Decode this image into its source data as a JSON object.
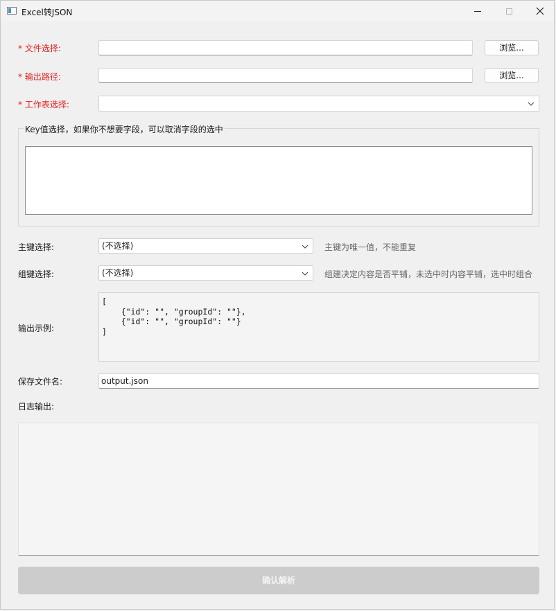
{
  "window": {
    "title": "Excel转JSON",
    "icons": {
      "app": "excel-json-app-icon",
      "minimize": "minimize-icon",
      "maximize": "maximize-icon",
      "close": "close-icon"
    }
  },
  "form": {
    "file": {
      "required_mark": "* ",
      "label": "文件选择:",
      "value": "",
      "browse_label": "浏览..."
    },
    "output": {
      "required_mark": "* ",
      "label": "输出路径:",
      "value": "",
      "browse_label": "浏览..."
    },
    "sheet": {
      "required_mark": "* ",
      "label": "工作表选择:",
      "value": ""
    },
    "key_group": {
      "title": "Key值选择，如果你不想要字段，可以取消字段的选中"
    },
    "primary_key": {
      "label": "主键选择:",
      "value": "(不选择)",
      "hint": "主键为唯一值，不能重复"
    },
    "group_key": {
      "label": "组键选择:",
      "value": "(不选择)",
      "hint": "组建决定内容是否平铺，未选中时内容平铺，选中时组合"
    },
    "sample": {
      "label": "输出示例:",
      "text": "[\n    {\"id\": \"\", \"groupId\": \"\"},\n    {\"id\": \"\", \"groupId\": \"\"}\n]"
    },
    "save_name": {
      "label": "保存文件名:",
      "value": "output.json"
    },
    "log": {
      "label": "日志输出:"
    },
    "confirm_label": "确认解析"
  }
}
